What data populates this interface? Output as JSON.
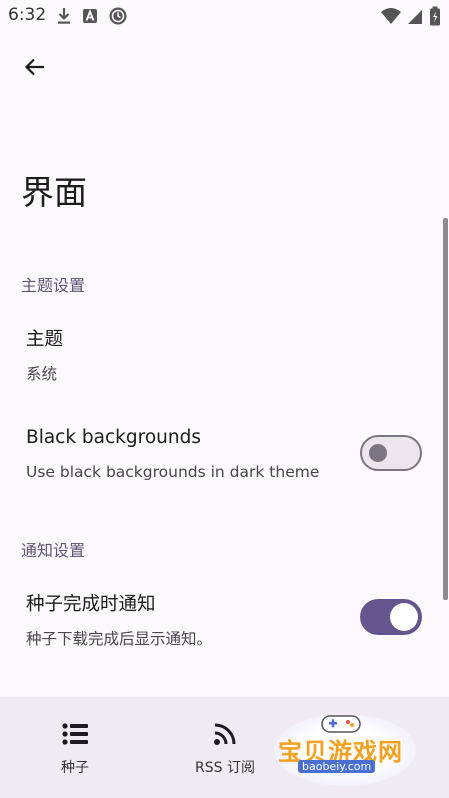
{
  "status_bar": {
    "time": "6:32"
  },
  "header": {
    "title": "界面"
  },
  "sections": [
    {
      "header": "主题设置",
      "items": [
        {
          "title": "主题",
          "summary": "系统"
        },
        {
          "title": "Black backgrounds",
          "summary": "Use black backgrounds in dark theme",
          "switch_on": false
        }
      ]
    },
    {
      "header": "通知设置",
      "items": [
        {
          "title": "种子完成时通知",
          "summary": "种子下载完成后显示通知。",
          "switch_on": true
        }
      ]
    }
  ],
  "bottom_nav": {
    "items": [
      {
        "label": "种子",
        "icon": "list-icon"
      },
      {
        "label": "RSS 订阅",
        "icon": "rss-icon"
      },
      {
        "label": "",
        "icon": "settings-icon"
      }
    ]
  },
  "watermark": {
    "title": "宝贝游戏网",
    "url": "baobeiy.com"
  },
  "colors": {
    "background": "#fdf7fe",
    "accent": "#65558f",
    "section_header": "#5f5478",
    "bottom_nav": "#f0ebf2"
  }
}
